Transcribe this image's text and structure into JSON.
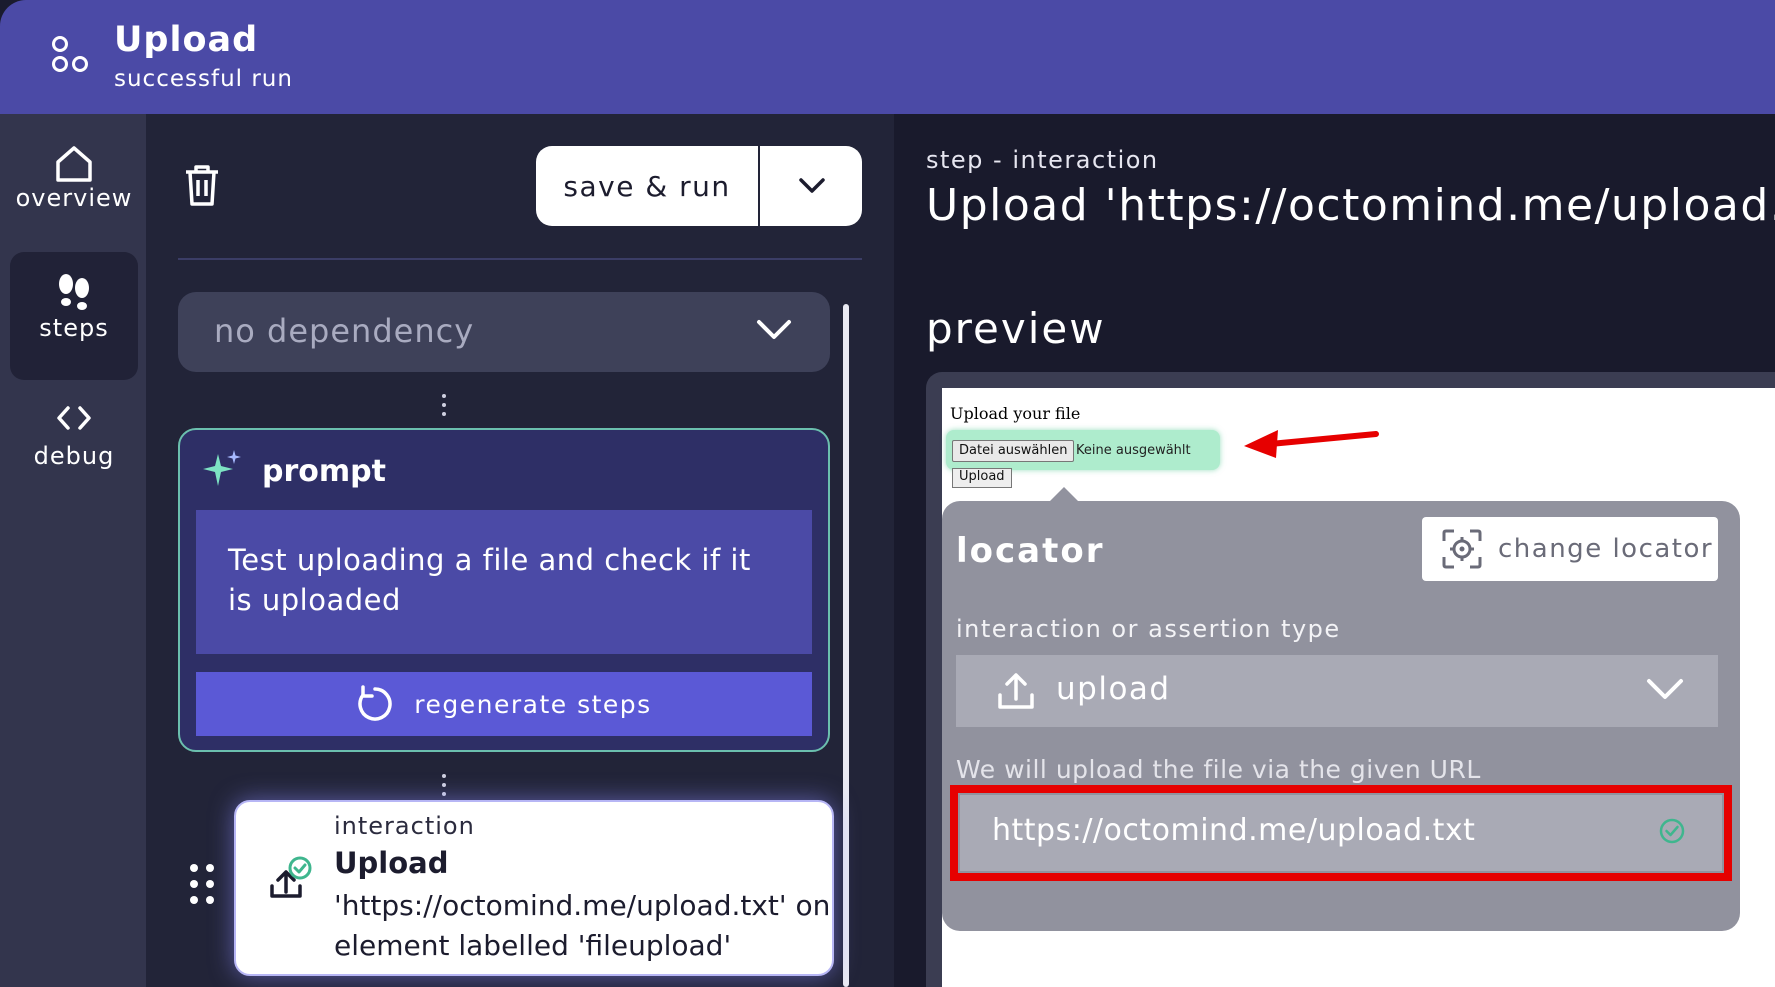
{
  "header": {
    "title": "Upload",
    "subtitle": "successful run"
  },
  "nav": {
    "items": [
      {
        "label": "overview",
        "icon": "home-icon",
        "active": false
      },
      {
        "label": "steps",
        "icon": "footprints-icon",
        "active": true
      },
      {
        "label": "debug",
        "icon": "code-icon",
        "active": false
      }
    ]
  },
  "toolbar": {
    "save_run_label": "save & run"
  },
  "dependency": {
    "selected": "no dependency"
  },
  "prompt": {
    "title": "prompt",
    "text": "Test uploading a file and check if it is uploaded",
    "regenerate_label": "regenerate steps"
  },
  "step": {
    "type": "interaction",
    "title": "Upload",
    "description": "'https://octomind.me/upload.txt' on element labelled 'fileupload'"
  },
  "detail": {
    "kicker": "step - interaction",
    "title": "Upload 'https://octomind.me/upload.txt' on element labelled 'fileupload'",
    "preview_label": "preview"
  },
  "preview_page": {
    "heading": "Upload your file",
    "file_button": "Datei auswählen",
    "file_status": "Keine ausgewählt",
    "upload_button": "Upload"
  },
  "locator": {
    "title": "locator",
    "change_label": "change locator",
    "interaction_label": "interaction or assertion type",
    "interaction_value": "upload",
    "url_label": "We will upload the file via the given URL",
    "url_value": "https://octomind.me/upload.txt"
  },
  "colors": {
    "header": "#4b4aa6",
    "accent": "#5b59d6",
    "highlight": "#aeeccd",
    "annotation_red": "#e60000",
    "success_green": "#3fb68e"
  }
}
